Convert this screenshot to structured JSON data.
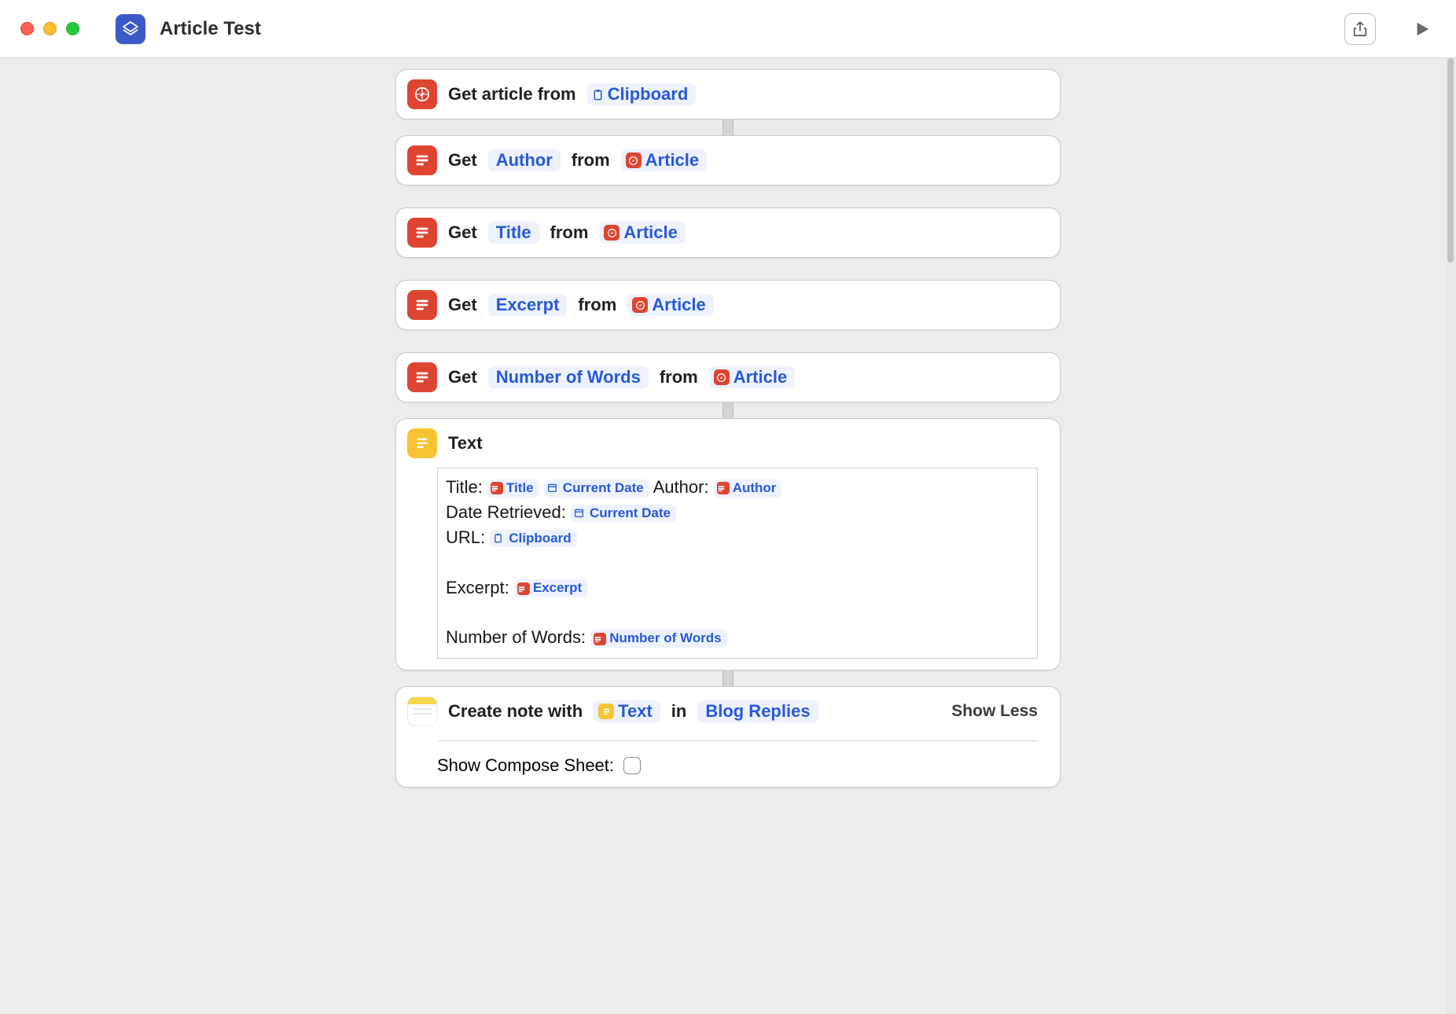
{
  "window": {
    "title": "Article Test"
  },
  "actions": {
    "a1": {
      "prefix": "Get article from",
      "token1": "Clipboard"
    },
    "a2": {
      "prefix": "Get",
      "param": "Author",
      "mid": "from",
      "src": "Article"
    },
    "a3": {
      "prefix": "Get",
      "param": "Title",
      "mid": "from",
      "src": "Article"
    },
    "a4": {
      "prefix": "Get",
      "param": "Excerpt",
      "mid": "from",
      "src": "Article"
    },
    "a5": {
      "prefix": "Get",
      "param": "Number of Words",
      "mid": "from",
      "src": "Article"
    },
    "a6": {
      "title": "Text"
    },
    "a7": {
      "prefix": "Create note with",
      "body": "Text",
      "mid": "in",
      "folder": "Blog Replies",
      "toggle_label": "Show Less",
      "compose_label": "Show Compose Sheet:"
    }
  },
  "textblock": {
    "l1_label": "Title:",
    "l1_tok1": "Title",
    "l1_tok2": "Current Date",
    "l1_label2": "Author:",
    "l1_tok3": "Author",
    "l2_label": "Date Retrieved:",
    "l2_tok1": "Current Date",
    "l3_label": "URL:",
    "l3_tok1": "Clipboard",
    "l4_label": "Excerpt:",
    "l4_tok1": "Excerpt",
    "l5_label": "Number of Words:",
    "l5_tok1": "Number of Words"
  }
}
